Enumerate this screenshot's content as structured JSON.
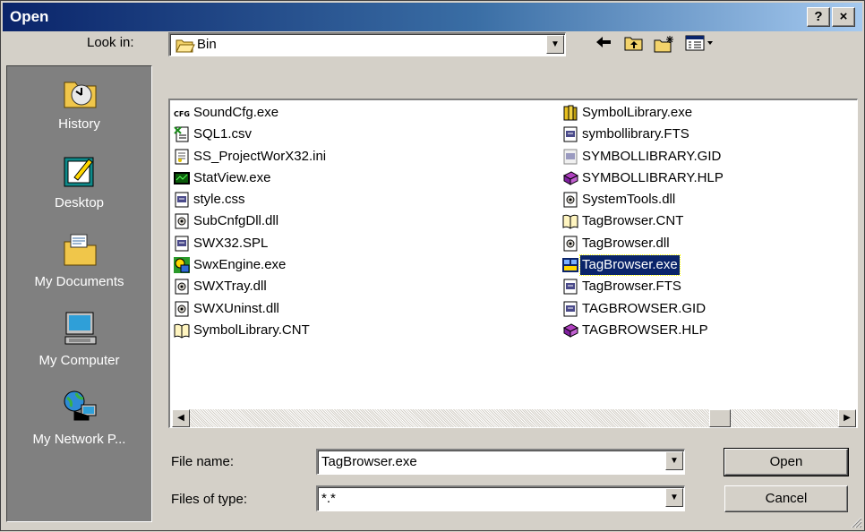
{
  "window": {
    "title": "Open",
    "help_btn": "?",
    "close_btn": "×"
  },
  "lookin": {
    "label": "Look in:",
    "value": "Bin"
  },
  "toolbar": [
    "back-icon",
    "up-folder-icon",
    "new-folder-icon",
    "view-menu-icon"
  ],
  "places": [
    {
      "label": "History",
      "icon": "history-icon"
    },
    {
      "label": "Desktop",
      "icon": "desktop-icon"
    },
    {
      "label": "My Documents",
      "icon": "my-documents-icon"
    },
    {
      "label": "My Computer",
      "icon": "my-computer-icon"
    },
    {
      "label": "My Network P...",
      "icon": "my-network-places-icon"
    }
  ],
  "files": {
    "col1": [
      {
        "name": "SoundCfg.exe",
        "icon": "cfg-app-icon"
      },
      {
        "name": "SQL1.csv",
        "icon": "csv-icon"
      },
      {
        "name": "SS_ProjectWorX32.ini",
        "icon": "ini-icon"
      },
      {
        "name": "StatView.exe",
        "icon": "statview-app-icon"
      },
      {
        "name": "style.css",
        "icon": "generic-doc-icon"
      },
      {
        "name": "SubCnfgDll.dll",
        "icon": "dll-icon"
      },
      {
        "name": "SWX32.SPL",
        "icon": "generic-doc-icon"
      },
      {
        "name": "SwxEngine.exe",
        "icon": "engine-app-icon"
      },
      {
        "name": "SWXTray.dll",
        "icon": "dll-icon"
      },
      {
        "name": "SWXUninst.dll",
        "icon": "dll-icon"
      },
      {
        "name": "SymbolLibrary.CNT",
        "icon": "help-contents-icon"
      }
    ],
    "col2": [
      {
        "name": "SymbolLibrary.exe",
        "icon": "library-app-icon"
      },
      {
        "name": "symbollibrary.FTS",
        "icon": "generic-doc-icon"
      },
      {
        "name": "SYMBOLLIBRARY.GID",
        "icon": "gid-icon"
      },
      {
        "name": "SYMBOLLIBRARY.HLP",
        "icon": "help-book-icon"
      },
      {
        "name": "SystemTools.dll",
        "icon": "dll-icon"
      },
      {
        "name": "TagBrowser.CNT",
        "icon": "help-contents-icon"
      },
      {
        "name": "TagBrowser.dll",
        "icon": "dll-icon"
      },
      {
        "name": "TagBrowser.exe",
        "icon": "tagbrowser-app-icon",
        "selected": true
      },
      {
        "name": "TagBrowser.FTS",
        "icon": "generic-doc-icon"
      },
      {
        "name": "TAGBROWSER.GID",
        "icon": "generic-doc-icon"
      },
      {
        "name": "TAGBROWSER.HLP",
        "icon": "help-book-icon"
      }
    ]
  },
  "filename": {
    "label": "File name:",
    "value": "TagBrowser.exe"
  },
  "filetype": {
    "label": "Files of type:",
    "value": "*.*"
  },
  "buttons": {
    "open": "Open",
    "cancel": "Cancel"
  }
}
